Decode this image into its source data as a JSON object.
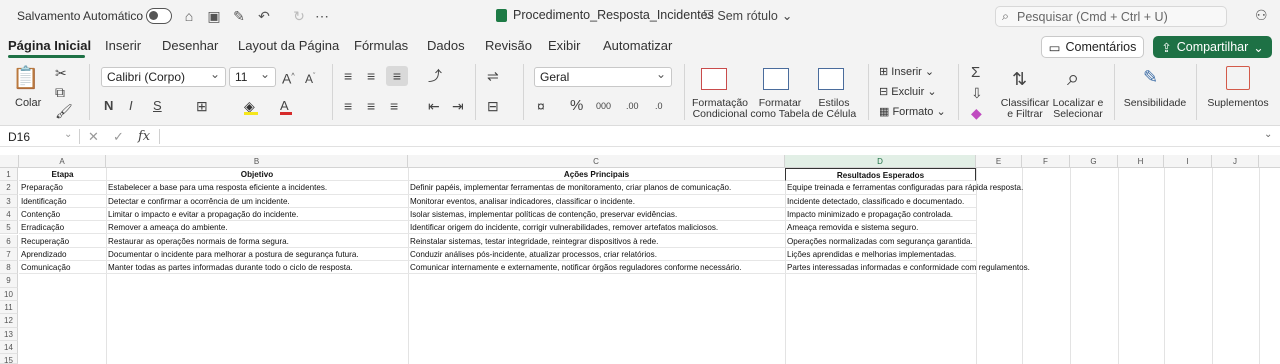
{
  "titlebar": {
    "autosave_label": "Salvamento Automático",
    "document_name": "Procedimento_Resposta_Incidentes",
    "sensitivity_label": "Sem rótulo",
    "search_placeholder": "Pesquisar (Cmd + Ctrl + U)"
  },
  "tabs": [
    "Página Inicial",
    "Inserir",
    "Desenhar",
    "Layout da Página",
    "Fórmulas",
    "Dados",
    "Revisão",
    "Exibir",
    "Automatizar"
  ],
  "actions": {
    "comments": "Comentários",
    "share": "Compartilhar"
  },
  "ribbon": {
    "paste": "Colar",
    "font_name": "Calibri (Corpo)",
    "font_size": "11",
    "bold": "N",
    "italic": "I",
    "underline": "S",
    "number_format": "Geral",
    "insert": "Inserir",
    "delete": "Excluir",
    "format": "Formato",
    "conditional_formatting": [
      "Formatação",
      "Condicional"
    ],
    "format_as_table": [
      "Formatar",
      "como Tabela"
    ],
    "cell_styles": [
      "Estilos",
      "de Célula"
    ],
    "sort_filter": [
      "Classificar",
      "e Filtrar"
    ],
    "find_select": [
      "Localizar e",
      "Selecionar"
    ],
    "sensitivity": "Sensibilidade",
    "addins": "Suplementos"
  },
  "formula_bar": {
    "name_box": "D16",
    "formula": ""
  },
  "columns": [
    "A",
    "B",
    "C",
    "D",
    "E",
    "F",
    "G",
    "H",
    "I",
    "J"
  ],
  "rows": [
    "1",
    "2",
    "3",
    "4",
    "5",
    "6",
    "7",
    "8",
    "9",
    "10",
    "11",
    "12",
    "13",
    "14",
    "15"
  ],
  "sheet": {
    "headers": [
      "Etapa",
      "Objetivo",
      "Ações Principais",
      "Resultados Esperados"
    ],
    "data": [
      [
        "Preparação",
        "Estabelecer a base para uma resposta eficiente a incidentes.",
        "Definir papéis, implementar ferramentas de monitoramento, criar planos de comunicação.",
        "Equipe treinada e ferramentas configuradas para rápida resposta."
      ],
      [
        "Identificação",
        "Detectar e confirmar a ocorrência de um incidente.",
        "Monitorar eventos, analisar indicadores, classificar o incidente.",
        "Incidente detectado, classificado e documentado."
      ],
      [
        "Contenção",
        "Limitar o impacto e evitar a propagação do incidente.",
        "Isolar sistemas, implementar políticas de contenção, preservar evidências.",
        "Impacto minimizado e propagação controlada."
      ],
      [
        "Erradicação",
        "Remover a ameaça do ambiente.",
        "Identificar origem do incidente, corrigir vulnerabilidades, remover artefatos maliciosos.",
        "Ameaça removida e sistema seguro."
      ],
      [
        "Recuperação",
        "Restaurar as operações normais de forma segura.",
        "Reinstalar sistemas, testar integridade, reintegrar dispositivos à rede.",
        "Operações normalizadas com segurança garantida."
      ],
      [
        "Aprendizado",
        "Documentar o incidente para melhorar a postura de segurança futura.",
        "Conduzir análises pós-incidente, atualizar processos, criar relatórios.",
        "Lições aprendidas e melhorias implementadas."
      ],
      [
        "Comunicação",
        "Manter todas as partes informadas durante todo o ciclo de resposta.",
        "Comunicar internamente e externamente, notificar órgãos reguladores conforme necessário.",
        "Partes interessadas informadas e conformidade com regulamentos."
      ]
    ]
  }
}
